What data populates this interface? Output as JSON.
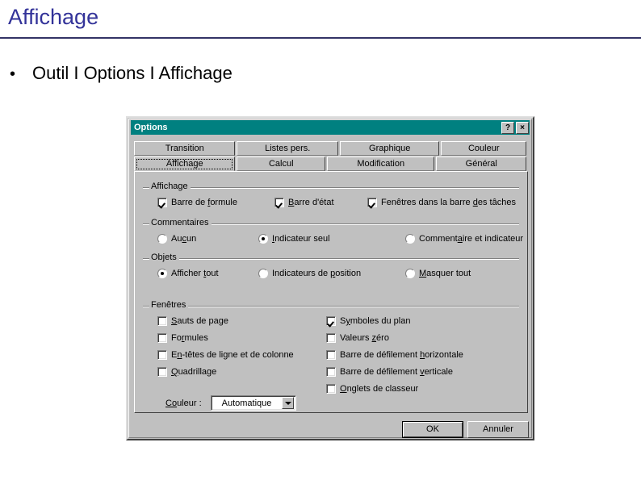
{
  "slide": {
    "title": "Affichage",
    "bullet_mark": "•",
    "bullet_text": "Outil I Options I Affichage",
    "title_color": "#333399",
    "rule_color": "#333366"
  },
  "dialog": {
    "titlebar": {
      "title": "Options",
      "background": "#008080",
      "help_button": "?",
      "close_button": "×"
    },
    "tabs_row_top": [
      {
        "label": "Transition",
        "active": false
      },
      {
        "label": "Listes pers.",
        "active": false
      },
      {
        "label": "Graphique",
        "active": false
      },
      {
        "label": "Couleur",
        "active": false
      }
    ],
    "tabs_row_bottom": [
      {
        "label": "Affichage",
        "active": true
      },
      {
        "label": "Calcul",
        "active": false
      },
      {
        "label": "Modification",
        "active": false
      },
      {
        "label": "Général",
        "active": false
      }
    ],
    "groups": {
      "affichage": {
        "label": "Affichage",
        "checkboxes": [
          {
            "label_pre": "Barre de ",
            "accel": "f",
            "label_post": "ormule",
            "checked": true
          },
          {
            "label_pre": "",
            "accel": "B",
            "label_post": "arre d'état",
            "checked": true
          },
          {
            "label_pre": "Fenêtres dans la barre ",
            "accel": "d",
            "label_post": "es tâches",
            "checked": true
          }
        ]
      },
      "commentaires": {
        "label": "Commentaires",
        "radios": [
          {
            "label_pre": "Au",
            "accel": "c",
            "label_post": "un",
            "checked": false
          },
          {
            "label_pre": "",
            "accel": "I",
            "label_post": "ndicateur seul",
            "checked": true
          },
          {
            "label_pre": "Comment",
            "accel": "a",
            "label_post": "ire et indicateur",
            "checked": false
          }
        ]
      },
      "objets": {
        "label": "Objets",
        "radios": [
          {
            "label_pre": "Afficher ",
            "accel": "t",
            "label_post": "out",
            "checked": true
          },
          {
            "label_pre": "Indicateurs de ",
            "accel": "p",
            "label_post": "osition",
            "checked": false
          },
          {
            "label_pre": "",
            "accel": "M",
            "label_post": "asquer tout",
            "checked": false
          }
        ]
      },
      "fenetres": {
        "label": "Fenêtres",
        "checkboxes_left": [
          {
            "label_pre": "",
            "accel": "S",
            "label_post": "auts de page",
            "checked": false
          },
          {
            "label_pre": "Fo",
            "accel": "r",
            "label_post": "mules",
            "checked": false
          },
          {
            "label_pre": "E",
            "accel": "n",
            "label_post": "-têtes de ligne et de colonne",
            "checked": false
          },
          {
            "label_pre": "",
            "accel": "Q",
            "label_post": "uadrillage",
            "checked": false
          }
        ],
        "checkboxes_right": [
          {
            "label_pre": "S",
            "accel": "y",
            "label_post": "mboles du plan",
            "checked": true
          },
          {
            "label_pre": "Valeurs ",
            "accel": "z",
            "label_post": "éro",
            "checked": false
          },
          {
            "label_pre": "Barre de défilement ",
            "accel": "h",
            "label_post": "orizontale",
            "checked": false
          },
          {
            "label_pre": "Barre de défilement ",
            "accel": "v",
            "label_post": "erticale",
            "checked": false
          },
          {
            "label_pre": "",
            "accel": "O",
            "label_post": "nglets de classeur",
            "checked": false
          }
        ],
        "couleur": {
          "label_pre": "",
          "accel": "Co",
          "label_post": "uleur :",
          "value": "Automatique"
        }
      }
    },
    "buttons": {
      "ok": "OK",
      "cancel": "Annuler"
    }
  }
}
